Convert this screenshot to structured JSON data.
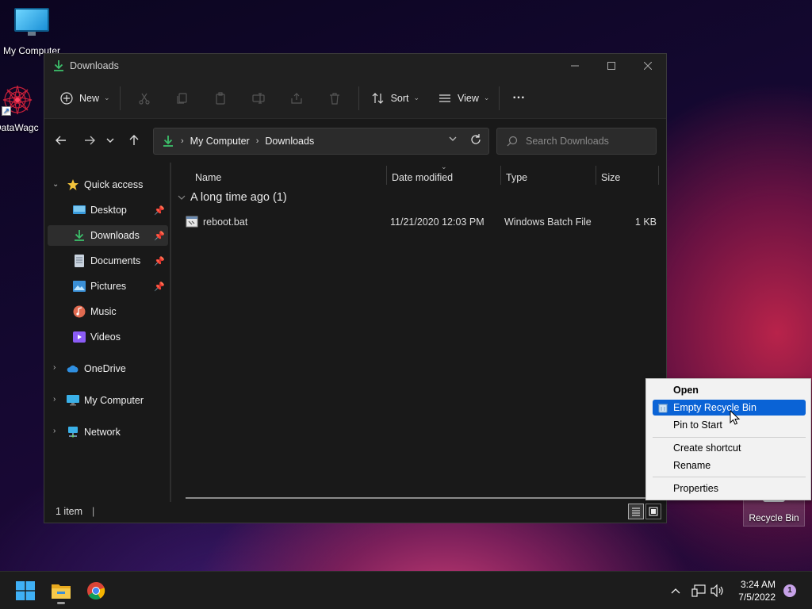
{
  "desktop": {
    "icons": [
      {
        "label": "My Computer",
        "icon": "monitor-icon"
      },
      {
        "label": "DataWagc",
        "icon": "mandala-shortcut-icon"
      }
    ],
    "recycle_bin_label": "Recycle Bin"
  },
  "window": {
    "title": "Downloads",
    "controls": [
      "minimize",
      "maximize",
      "close"
    ]
  },
  "toolbar": {
    "new_label": "New",
    "sort_label": "Sort",
    "view_label": "View",
    "more_label": "···"
  },
  "navbar": {
    "breadcrumb": [
      "My Computer",
      "Downloads"
    ],
    "search_placeholder": "Search Downloads"
  },
  "nav_pane": {
    "quick_access": "Quick access",
    "items": [
      {
        "label": "Desktop",
        "icon": "desktop-folder-icon",
        "pinned": true
      },
      {
        "label": "Downloads",
        "icon": "downloads-icon",
        "pinned": true,
        "selected": true
      },
      {
        "label": "Documents",
        "icon": "documents-icon",
        "pinned": true
      },
      {
        "label": "Pictures",
        "icon": "pictures-icon",
        "pinned": true
      },
      {
        "label": "Music",
        "icon": "music-icon"
      },
      {
        "label": "Videos",
        "icon": "videos-icon"
      }
    ],
    "roots": [
      {
        "label": "OneDrive",
        "icon": "onedrive-icon"
      },
      {
        "label": "My Computer",
        "icon": "monitor-icon"
      },
      {
        "label": "Network",
        "icon": "network-icon"
      }
    ]
  },
  "file_list": {
    "columns": [
      "Name",
      "Date modified",
      "Type",
      "Size"
    ],
    "group_label": "A long time ago (1)",
    "rows": [
      {
        "name": "reboot.bat",
        "date": "11/21/2020 12:03 PM",
        "type": "Windows Batch File",
        "size": "1 KB"
      }
    ]
  },
  "statusbar": {
    "count": "1 item",
    "separator": "|"
  },
  "context_menu": {
    "items": [
      {
        "label": "Open",
        "bold": true
      },
      {
        "label": "Empty Recycle Bin",
        "highlighted": true
      },
      {
        "label": "Pin to Start"
      },
      {
        "label": "Create shortcut"
      },
      {
        "label": "Rename"
      },
      {
        "label": "Properties"
      }
    ]
  },
  "taskbar": {
    "apps": [
      "start-icon",
      "file-explorer-icon",
      "chrome-icon"
    ],
    "time": "3:24 AM",
    "date": "7/5/2022",
    "notification_count": "1"
  },
  "colors": {
    "accent": "#0a63d6",
    "download_green": "#3cbf6a",
    "folder_yellow": "#f3c43c"
  }
}
